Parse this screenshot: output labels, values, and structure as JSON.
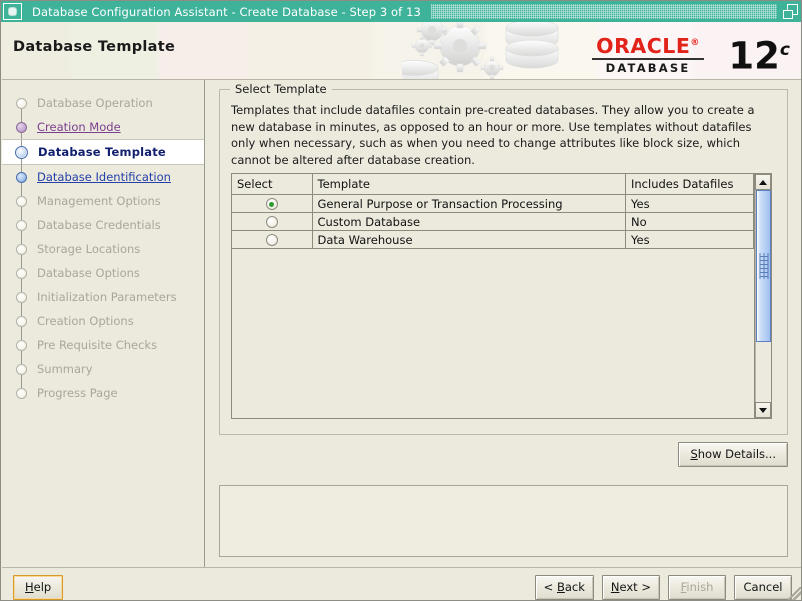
{
  "window": {
    "title": "Database Configuration Assistant - Create Database - Step 3 of 13",
    "menu_icon": "window-menu-icon",
    "restore_icon": "window-restore-icon",
    "titlebar_color": "#3fb39a"
  },
  "banner": {
    "page_title": "Database Template",
    "brand": "ORACLE",
    "brand_sub": "DATABASE",
    "version_number": "12",
    "version_suffix": "c",
    "brand_color": "#e2231a"
  },
  "sidebar": {
    "items": [
      {
        "label": "Database Operation",
        "state": "disabled",
        "bullet": "todo"
      },
      {
        "label": "Creation Mode",
        "state": "done",
        "bullet": "done"
      },
      {
        "label": "Database Template",
        "state": "active",
        "bullet": "current"
      },
      {
        "label": "Database Identification",
        "state": "next",
        "bullet": "next"
      },
      {
        "label": "Management Options",
        "state": "disabled",
        "bullet": "todo"
      },
      {
        "label": "Database Credentials",
        "state": "disabled",
        "bullet": "todo"
      },
      {
        "label": "Storage Locations",
        "state": "disabled",
        "bullet": "todo"
      },
      {
        "label": "Database Options",
        "state": "disabled",
        "bullet": "todo"
      },
      {
        "label": "Initialization Parameters",
        "state": "disabled",
        "bullet": "todo"
      },
      {
        "label": "Creation Options",
        "state": "disabled",
        "bullet": "todo"
      },
      {
        "label": "Pre Requisite Checks",
        "state": "disabled",
        "bullet": "todo"
      },
      {
        "label": "Summary",
        "state": "disabled",
        "bullet": "todo"
      },
      {
        "label": "Progress Page",
        "state": "disabled",
        "bullet": "todo"
      }
    ]
  },
  "main": {
    "groupbox_title": "Select Template",
    "description": "Templates that include datafiles contain pre-created databases. They allow you to create a new database in minutes, as opposed to an hour or more. Use templates without datafiles only when necessary, such as when you need to change attributes like block size, which cannot be altered after database creation.",
    "table": {
      "columns": [
        "Select",
        "Template",
        "Includes Datafiles"
      ],
      "rows": [
        {
          "selected": true,
          "template": "General Purpose or Transaction Processing",
          "includes_datafiles": "Yes"
        },
        {
          "selected": false,
          "template": "Custom Database",
          "includes_datafiles": "No"
        },
        {
          "selected": false,
          "template": "Data Warehouse",
          "includes_datafiles": "Yes"
        }
      ]
    },
    "show_details_label": "Show Details...",
    "show_details_mnemonic": "S",
    "details_panel_text": ""
  },
  "footer": {
    "help_label": "Help",
    "help_mnemonic": "H",
    "back_label": "< Back",
    "back_mnemonic": "B",
    "next_label": "Next >",
    "next_mnemonic": "N",
    "finish_label": "Finish",
    "finish_mnemonic": "F",
    "finish_disabled": true,
    "cancel_label": "Cancel"
  }
}
